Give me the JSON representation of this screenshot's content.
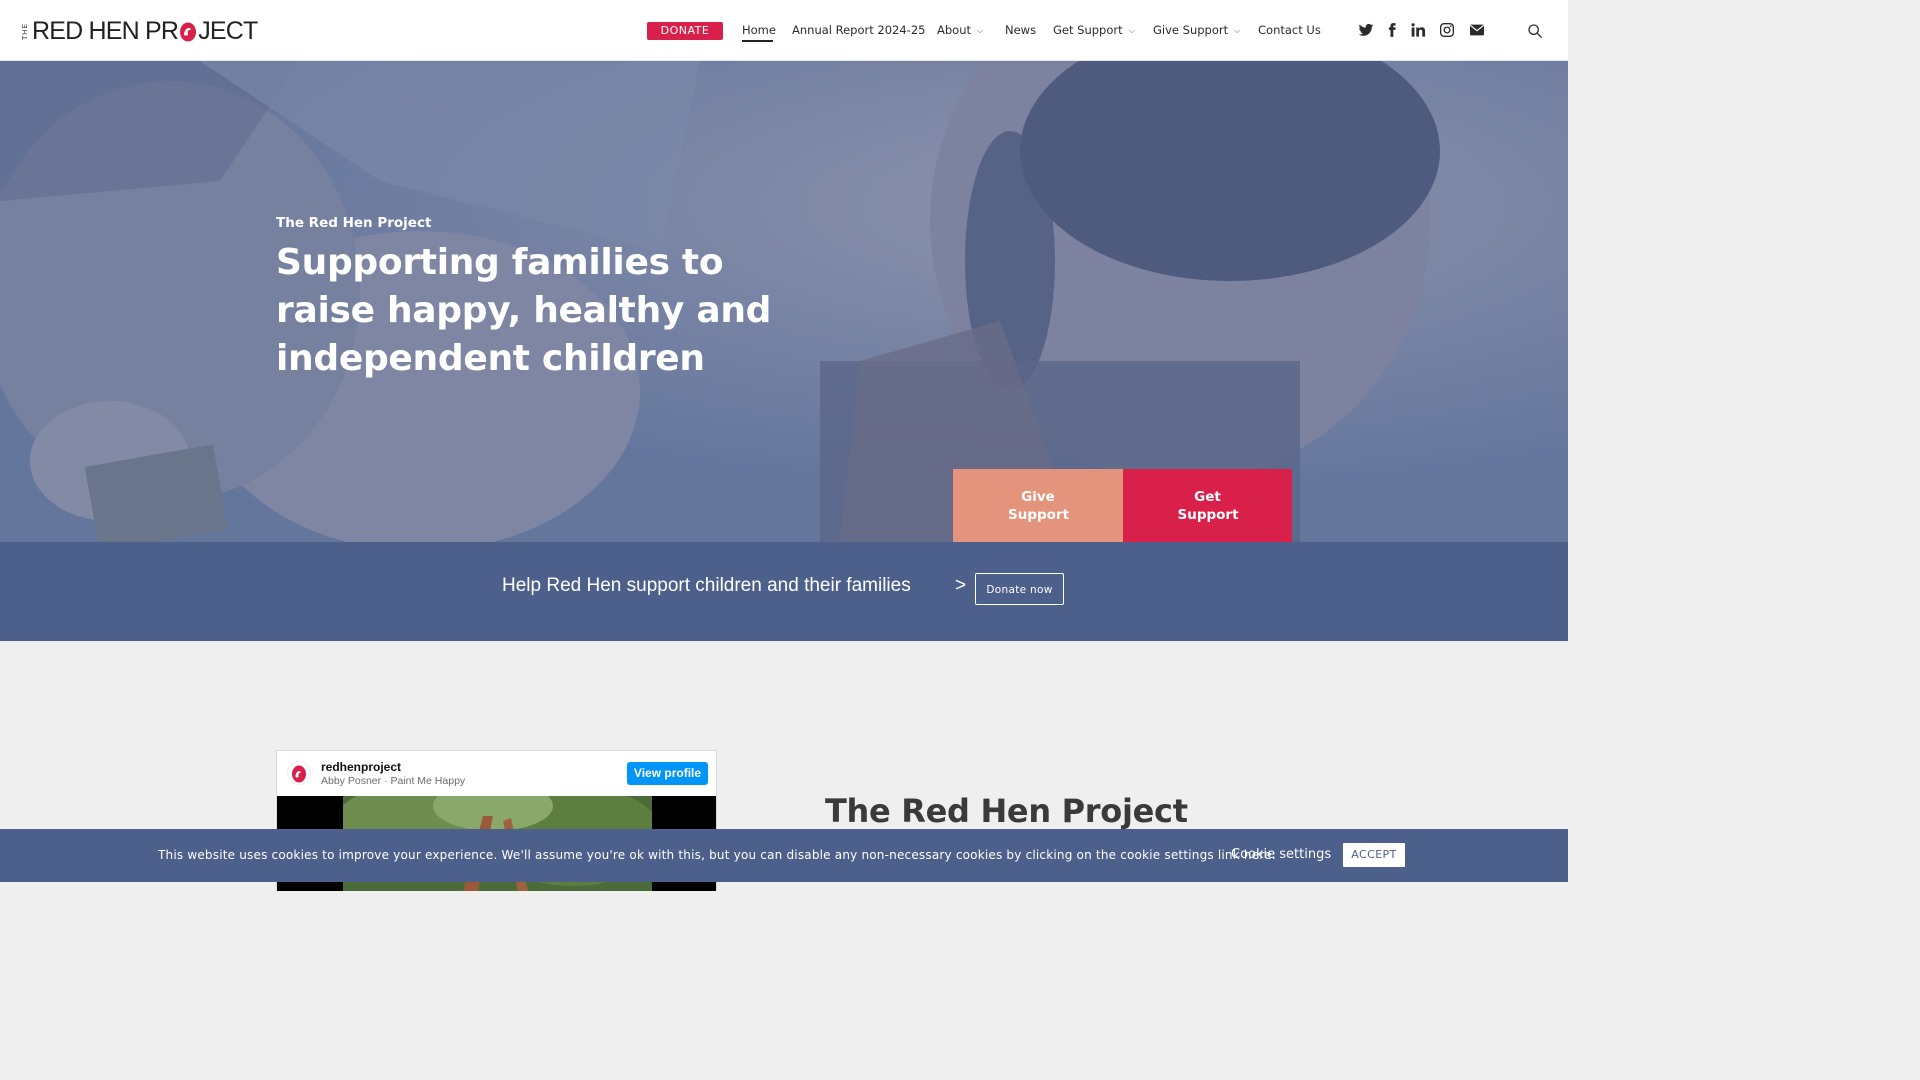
{
  "brand": {
    "logo_prefix": "THE",
    "logo_part1": "RED HEN PR",
    "logo_part2": "JECT"
  },
  "nav": {
    "donate_label": "DONATE",
    "items": [
      {
        "label": "Home",
        "active": true
      },
      {
        "label": "Annual Report 2024-25"
      },
      {
        "label": "About",
        "has_dropdown": true
      },
      {
        "label": "News"
      },
      {
        "label": "Get Support",
        "has_dropdown": true
      },
      {
        "label": "Give Support",
        "has_dropdown": true
      },
      {
        "label": "Contact Us"
      }
    ],
    "social_icons": [
      "twitter-icon",
      "facebook-icon",
      "linkedin-icon",
      "instagram-icon",
      "email-icon"
    ],
    "search_icon": "search-icon"
  },
  "hero": {
    "kicker": "The Red Hen Project",
    "title": "Supporting families to raise happy, healthy and independent children",
    "give_support": "Give Support",
    "get_support": "Get Support"
  },
  "band": {
    "text": "Help Red Hen support children and their families",
    "arrow": ">",
    "button": "Donate now"
  },
  "instagram": {
    "username": "redhenproject",
    "subtitle": "Abby Posner · Paint Me Happy",
    "view_profile": "View profile"
  },
  "section": {
    "title": "The Red Hen Project"
  },
  "cookie": {
    "text": "This website uses cookies to improve your experience. We'll assume you're ok with this, but you can disable any non-necessary cookies by clicking on the cookie settings link here:",
    "settings": "Cookie settings",
    "accept": "ACCEPT"
  },
  "colors": {
    "brand_red": "#d9204a",
    "salmon": "#e4937c",
    "navy": "#4d5f8b",
    "instagram_blue": "#0095f6"
  }
}
